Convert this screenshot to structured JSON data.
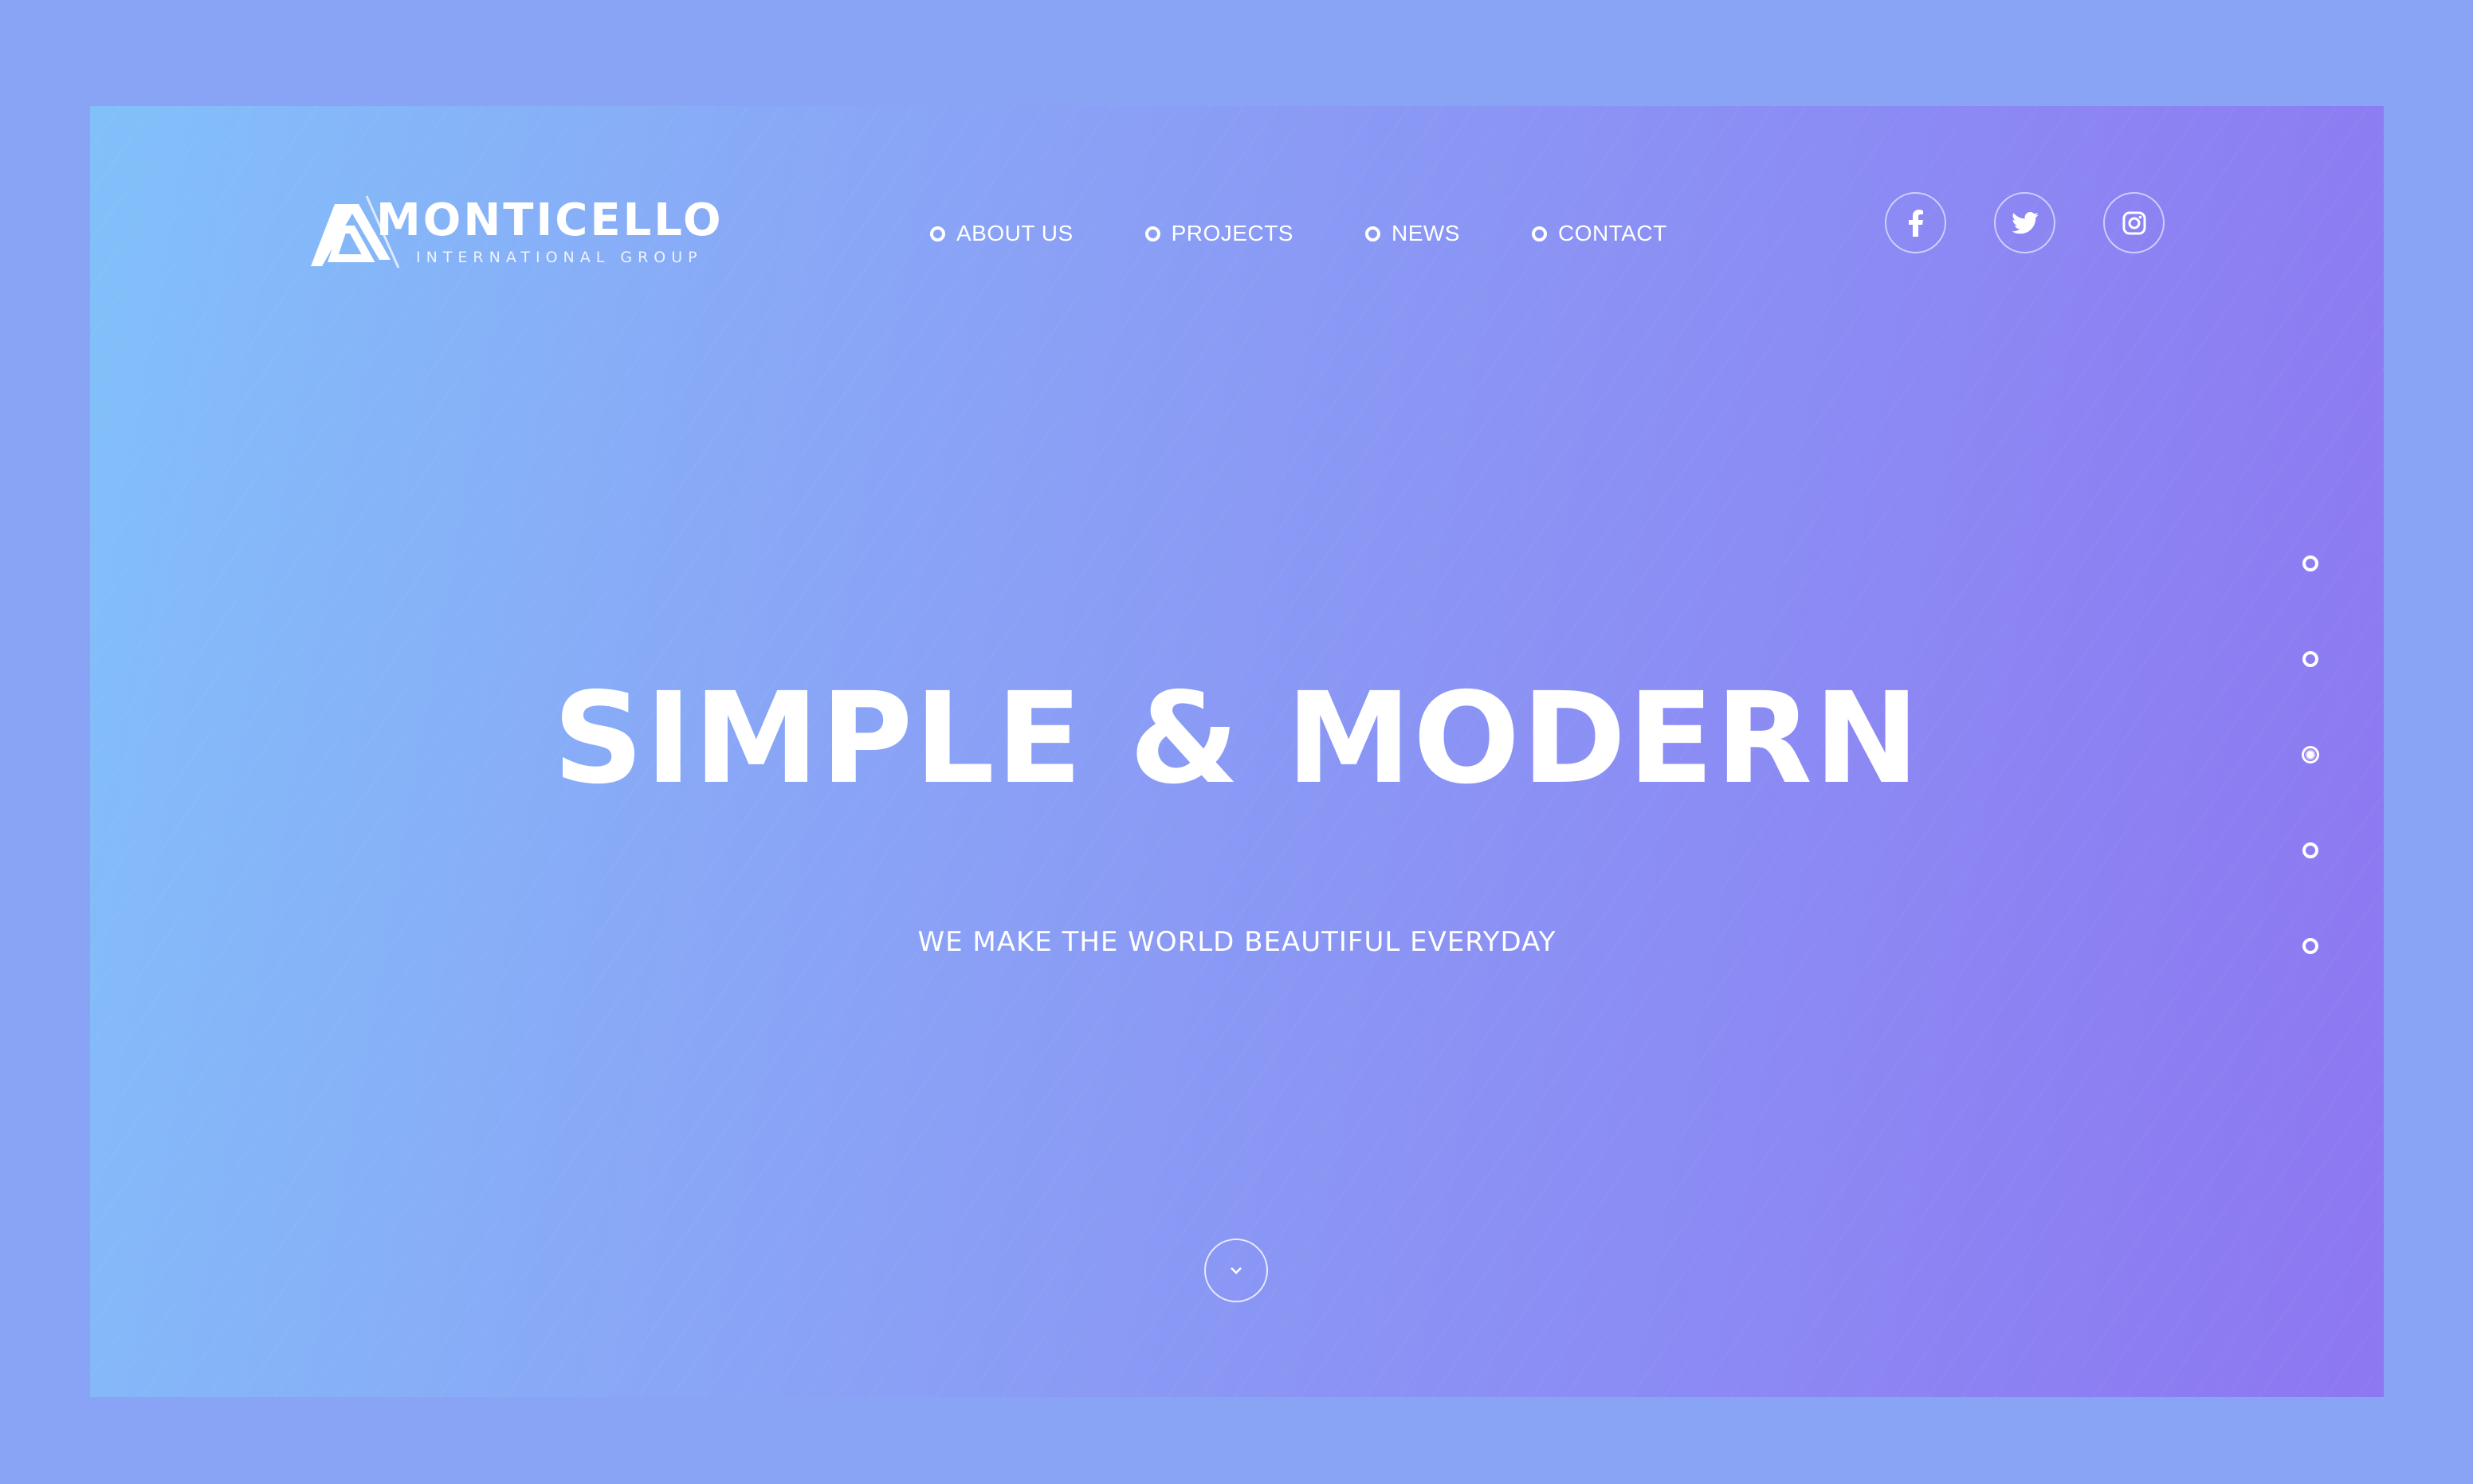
{
  "brand": {
    "name": "MONTICELLO",
    "tagline": "INTERNATIONAL GROUP"
  },
  "nav": {
    "items": [
      {
        "label": "ABOUT US"
      },
      {
        "label": "PROJECTS"
      },
      {
        "label": "NEWS"
      },
      {
        "label": "CONTACT"
      }
    ]
  },
  "social": {
    "icons": [
      "facebook-icon",
      "twitter-icon",
      "instagram-icon"
    ]
  },
  "hero": {
    "title": "SIMPLE & MODERN",
    "subtitle": "WE MAKE THE WORLD BEAUTIFUL EVERYDAY"
  },
  "pager": {
    "count": 5,
    "active_index": 2
  },
  "colors": {
    "page_bg": "#8aa4f5",
    "gradient_start": "#82c0fa",
    "gradient_end": "#8d77f2",
    "text": "#ffffff"
  },
  "icons": {
    "scroll": "chevron-down-icon"
  }
}
